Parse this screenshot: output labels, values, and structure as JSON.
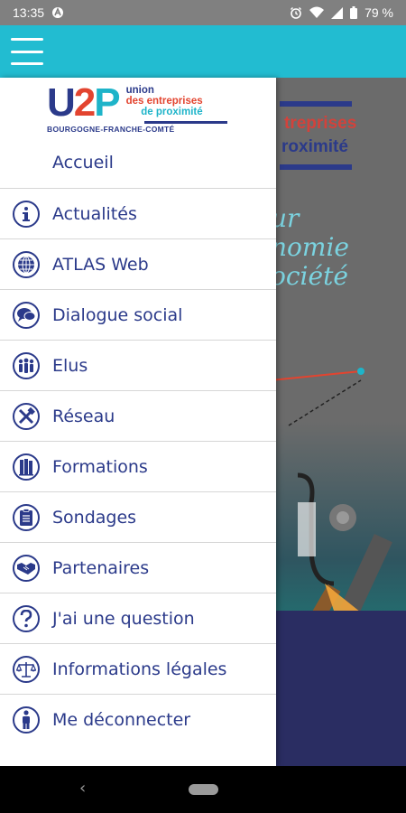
{
  "status_bar": {
    "time": "13:35",
    "battery": "79 %"
  },
  "app_bar": {
    "menu_icon": "hamburger-menu-icon"
  },
  "background": {
    "line1": "treprises",
    "line2": "roximité",
    "script": "ur\nnomie\nociété"
  },
  "drawer": {
    "logo": {
      "u": "U",
      "two": "2",
      "p": "P",
      "union": "union",
      "des": "des entreprises",
      "prox": "de proximité",
      "region": "BOURGOGNE-FRANCHE-COMTÉ"
    },
    "home_label": "Accueil",
    "items": [
      {
        "label": "Actualités",
        "icon": "info-icon"
      },
      {
        "label": "ATLAS Web",
        "icon": "globe-icon"
      },
      {
        "label": "Dialogue social",
        "icon": "chat-bubbles-icon"
      },
      {
        "label": "Elus",
        "icon": "people-group-icon"
      },
      {
        "label": "Réseau",
        "icon": "tools-icon"
      },
      {
        "label": "Formations",
        "icon": "books-icon"
      },
      {
        "label": "Sondages",
        "icon": "clipboard-icon"
      },
      {
        "label": "Partenaires",
        "icon": "handshake-icon"
      },
      {
        "label": "J'ai une question",
        "icon": "question-icon"
      },
      {
        "label": "Informations légales",
        "icon": "scales-icon"
      },
      {
        "label": "Me déconnecter",
        "icon": "person-icon"
      }
    ]
  },
  "colors": {
    "app_bar": "#22bcd1",
    "brand_blue": "#2b3a8a",
    "brand_red": "#e3442f",
    "brand_cyan": "#1eb4c9"
  }
}
